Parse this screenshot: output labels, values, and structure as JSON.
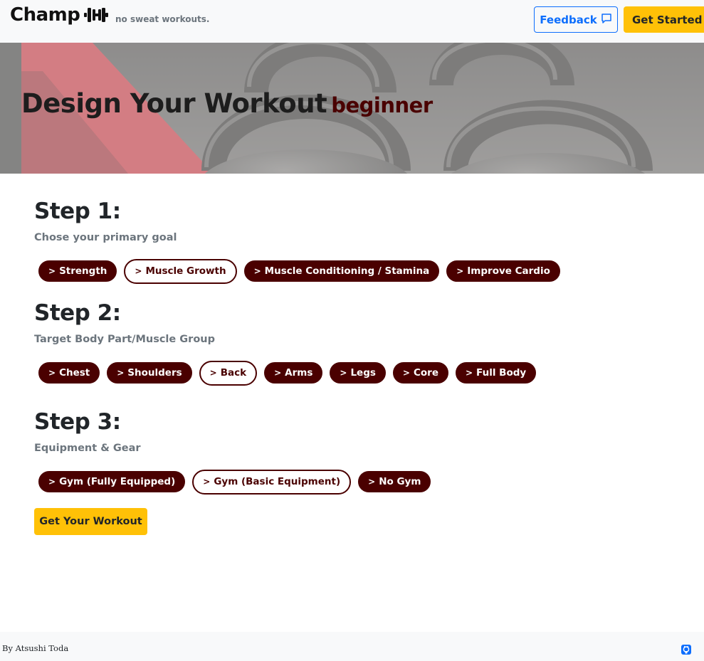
{
  "navbar": {
    "brand": "Champ",
    "brand_icon": "dumbbell-icon",
    "tagline": "no sweat workouts.",
    "feedback_label": "Feedback",
    "feedback_icon": "chat-icon",
    "get_started_label": "Get Started",
    "get_started_icon": "arrow-icon"
  },
  "hero": {
    "title": "Design Your Workout",
    "level": "beginner"
  },
  "steps": [
    {
      "title": "Step 1:",
      "subtitle": "Chose your primary goal",
      "options": [
        {
          "label": "Strength",
          "selected": false
        },
        {
          "label": "Muscle Growth",
          "selected": true
        },
        {
          "label": "Muscle Conditioning / Stamina",
          "selected": false
        },
        {
          "label": "Improve Cardio",
          "selected": false
        }
      ]
    },
    {
      "title": "Step 2:",
      "subtitle": "Target Body Part/Muscle Group",
      "options": [
        {
          "label": "Chest",
          "selected": false
        },
        {
          "label": "Shoulders",
          "selected": false
        },
        {
          "label": "Back",
          "selected": true
        },
        {
          "label": "Arms",
          "selected": false
        },
        {
          "label": "Legs",
          "selected": false
        },
        {
          "label": "Core",
          "selected": false
        },
        {
          "label": "Full Body",
          "selected": false
        }
      ]
    },
    {
      "title": "Step 3:",
      "subtitle": "Equipment & Gear",
      "options": [
        {
          "label": "Gym (Fully Equipped)",
          "selected": false
        },
        {
          "label": "Gym (Basic Equipment)",
          "selected": true
        },
        {
          "label": "No Gym",
          "selected": false
        }
      ]
    }
  ],
  "pill_prefix": ">",
  "submit_label": "Get Your Workout",
  "footer": {
    "author": "By Atsushi Toda",
    "github_icon": "github-icon"
  },
  "colors": {
    "accent": "#4a0000",
    "primary": "#0d6efd",
    "warning": "#ffc107"
  }
}
